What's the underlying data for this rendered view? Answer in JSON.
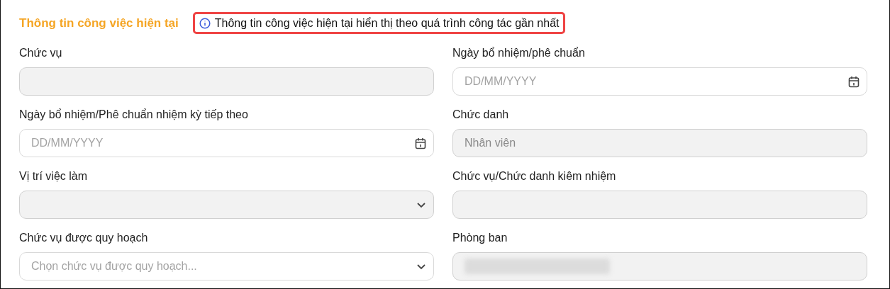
{
  "section": {
    "title": "Thông tin công việc hiện tại",
    "notice": "Thông tin công việc hiện tại hiển thị theo quá trình công tác gần nhất"
  },
  "fields": [
    {
      "label": "Chức vụ",
      "kind": "text",
      "disabled": true
    },
    {
      "label": "Ngày bổ nhiệm/phê chuẩn",
      "kind": "date",
      "disabled": false,
      "placeholder": "DD/MM/YYYY"
    },
    {
      "label": "Ngày bổ nhiệm/Phê chuẩn nhiệm kỳ tiếp theo",
      "kind": "date",
      "disabled": false,
      "placeholder": "DD/MM/YYYY"
    },
    {
      "label": "Chức danh",
      "kind": "text",
      "disabled": true,
      "value": "Nhân viên"
    },
    {
      "label": "Vị trí việc làm",
      "kind": "select",
      "disabled": true
    },
    {
      "label": "Chức vụ/Chức danh kiêm nhiệm",
      "kind": "text",
      "disabled": true
    },
    {
      "label": "Chức vụ được quy hoạch",
      "kind": "select",
      "disabled": false,
      "placeholder": "Chọn chức vụ được quy hoạch..."
    },
    {
      "label": "Phòng ban",
      "kind": "text",
      "disabled": true,
      "redacted": true
    }
  ]
}
